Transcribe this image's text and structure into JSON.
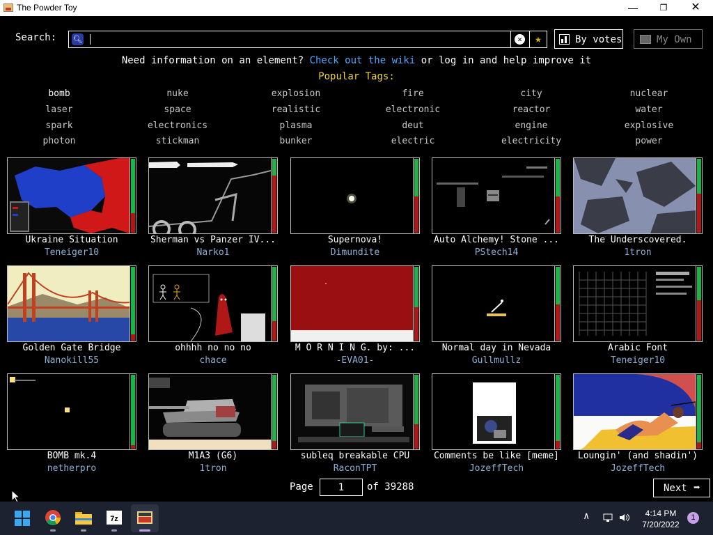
{
  "window": {
    "title": "The Powder Toy"
  },
  "search": {
    "label": "Search:",
    "value": "",
    "placeholder": ""
  },
  "toolbar": {
    "sort_label": "By votes",
    "myown_label": "My Own"
  },
  "info": {
    "prefix": "Need information on an element?",
    "link": "Check out the wiki",
    "suffix": "or log in and help improve it"
  },
  "tags": {
    "title": "Popular Tags:",
    "items": [
      "bomb",
      "nuke",
      "explosion",
      "fire",
      "city",
      "nuclear",
      "laser",
      "space",
      "realistic",
      "electronic",
      "reactor",
      "water",
      "spark",
      "electronics",
      "plasma",
      "deut",
      "engine",
      "explosive",
      "photon",
      "stickman",
      "bunker",
      "electric",
      "electricity",
      "power"
    ]
  },
  "saves": [
    {
      "name": "Ukraine Situation",
      "author": "Teneiger10",
      "upvote_ratio": 0.74
    },
    {
      "name": "Sherman vs Panzer IV...",
      "author": "Narko1",
      "upvote_ratio": 0.24
    },
    {
      "name": "Supernova!",
      "author": "Dimundite",
      "upvote_ratio": 0.52
    },
    {
      "name": "Auto Alchemy! Stone ...",
      "author": "PStech14",
      "upvote_ratio": 0.52
    },
    {
      "name": "The Underscovered.",
      "author": "1tron",
      "upvote_ratio": 0.48
    },
    {
      "name": "Golden Gate Bridge",
      "author": "Nanokill55",
      "upvote_ratio": 0.92
    },
    {
      "name": "ohhhh no no no",
      "author": "chace",
      "upvote_ratio": 0.74
    },
    {
      "name": "M O R N I N G. by: ...",
      "author": "-EVA01-",
      "upvote_ratio": 0.56
    },
    {
      "name": "Normal day in Nevada",
      "author": "Gullmullz",
      "upvote_ratio": 0.52
    },
    {
      "name": "Arabic Font",
      "author": "Teneiger10",
      "upvote_ratio": 0.46
    },
    {
      "name": "BOMB mk.4",
      "author": "netherpro",
      "upvote_ratio": 0.95
    },
    {
      "name": "M1A3 (G6)",
      "author": "1tron",
      "upvote_ratio": 0.9
    },
    {
      "name": "subleq breakable CPU",
      "author": "RaconTPT",
      "upvote_ratio": 0.68
    },
    {
      "name": "Comments be like [meme]",
      "author": "JozeffTech",
      "upvote_ratio": 0.9
    },
    {
      "name": "Loungin' (and shadin')",
      "author": "JozeffTech",
      "upvote_ratio": 0.92
    }
  ],
  "pagination": {
    "page_label": "Page",
    "current_page": "1",
    "of_label": "of 39288",
    "next_label": "Next"
  },
  "taskbar": {
    "time": "4:14 PM",
    "date": "7/20/2022",
    "notifications": "1"
  },
  "colors": {
    "link": "#4fa8ff",
    "tags_title": "#f0d040",
    "author": "#8ab0d8",
    "vote_up": "#1db34a",
    "vote_down": "#b01818"
  }
}
